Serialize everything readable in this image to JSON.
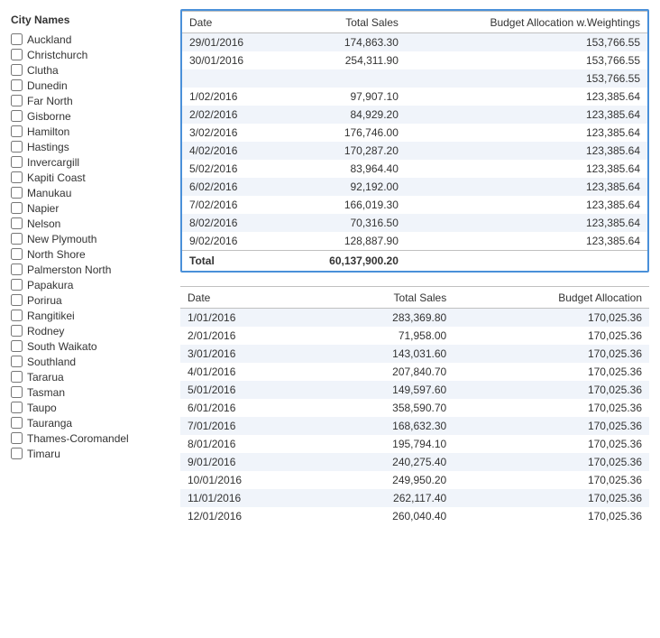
{
  "sidebar": {
    "header": "City Names",
    "cities": [
      {
        "name": "Auckland",
        "checked": false
      },
      {
        "name": "Christchurch",
        "checked": false
      },
      {
        "name": "Clutha",
        "checked": false
      },
      {
        "name": "Dunedin",
        "checked": false
      },
      {
        "name": "Far North",
        "checked": false
      },
      {
        "name": "Gisborne",
        "checked": false
      },
      {
        "name": "Hamilton",
        "checked": false
      },
      {
        "name": "Hastings",
        "checked": false
      },
      {
        "name": "Invercargill",
        "checked": false
      },
      {
        "name": "Kapiti Coast",
        "checked": false
      },
      {
        "name": "Manukau",
        "checked": false
      },
      {
        "name": "Napier",
        "checked": false
      },
      {
        "name": "Nelson",
        "checked": false
      },
      {
        "name": "New Plymouth",
        "checked": false
      },
      {
        "name": "North Shore",
        "checked": false
      },
      {
        "name": "Palmerston North",
        "checked": false
      },
      {
        "name": "Papakura",
        "checked": false
      },
      {
        "name": "Porirua",
        "checked": false
      },
      {
        "name": "Rangitikei",
        "checked": false
      },
      {
        "name": "Rodney",
        "checked": false
      },
      {
        "name": "South Waikato",
        "checked": false
      },
      {
        "name": "Southland",
        "checked": false
      },
      {
        "name": "Tararua",
        "checked": false
      },
      {
        "name": "Tasman",
        "checked": false
      },
      {
        "name": "Taupo",
        "checked": false
      },
      {
        "name": "Tauranga",
        "checked": false
      },
      {
        "name": "Thames-Coromandel",
        "checked": false
      },
      {
        "name": "Timaru",
        "checked": false
      }
    ]
  },
  "table1": {
    "columns": [
      "Date",
      "Total Sales",
      "Budget Allocation w.Weightings"
    ],
    "rows": [
      [
        "29/01/2016",
        "174,863.30",
        "153,766.55"
      ],
      [
        "30/01/2016",
        "254,311.90",
        "153,766.55"
      ],
      [
        "",
        "",
        "153,766.55"
      ],
      [
        "1/02/2016",
        "97,907.10",
        "123,385.64"
      ],
      [
        "2/02/2016",
        "84,929.20",
        "123,385.64"
      ],
      [
        "3/02/2016",
        "176,746.00",
        "123,385.64"
      ],
      [
        "4/02/2016",
        "170,287.20",
        "123,385.64"
      ],
      [
        "5/02/2016",
        "83,964.40",
        "123,385.64"
      ],
      [
        "6/02/2016",
        "92,192.00",
        "123,385.64"
      ],
      [
        "7/02/2016",
        "166,019.30",
        "123,385.64"
      ],
      [
        "8/02/2016",
        "70,316.50",
        "123,385.64"
      ],
      [
        "9/02/2016",
        "128,887.90",
        "123,385.64"
      ]
    ],
    "footer": [
      "Total",
      "60,137,900.20",
      ""
    ]
  },
  "table2": {
    "columns": [
      "Date",
      "Total Sales",
      "Budget Allocation"
    ],
    "rows": [
      [
        "1/01/2016",
        "283,369.80",
        "170,025.36"
      ],
      [
        "2/01/2016",
        "71,958.00",
        "170,025.36"
      ],
      [
        "3/01/2016",
        "143,031.60",
        "170,025.36"
      ],
      [
        "4/01/2016",
        "207,840.70",
        "170,025.36"
      ],
      [
        "5/01/2016",
        "149,597.60",
        "170,025.36"
      ],
      [
        "6/01/2016",
        "358,590.70",
        "170,025.36"
      ],
      [
        "7/01/2016",
        "168,632.30",
        "170,025.36"
      ],
      [
        "8/01/2016",
        "195,794.10",
        "170,025.36"
      ],
      [
        "9/01/2016",
        "240,275.40",
        "170,025.36"
      ],
      [
        "10/01/2016",
        "249,950.20",
        "170,025.36"
      ],
      [
        "11/01/2016",
        "262,117.40",
        "170,025.36"
      ],
      [
        "12/01/2016",
        "260,040.40",
        "170,025.36"
      ]
    ]
  }
}
